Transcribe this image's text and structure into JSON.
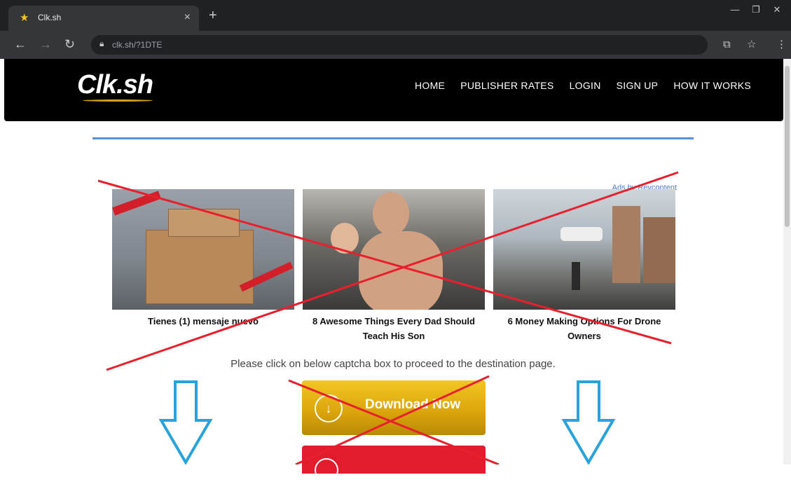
{
  "browser": {
    "tab_title": "Clk.sh",
    "tab_close": "×",
    "new_tab": "+",
    "url": "clk.sh/?1DTE",
    "window_controls": [
      "—",
      "❐",
      "✕"
    ]
  },
  "site": {
    "logo": "Clk.sh",
    "nav": [
      "HOME",
      "PUBLISHER RATES",
      "LOGIN",
      "SIGN UP",
      "HOW IT WORKS"
    ]
  },
  "ads": {
    "ads_by": "Ads by Revcontent",
    "cards": [
      {
        "title": "Tienes (1) mensaje nuevo"
      },
      {
        "title": "8 Awesome Things Every Dad Should Teach His Son"
      },
      {
        "title": "6 Money Making Options For Drone Owners"
      }
    ]
  },
  "instruction": "Please click on below captcha box to proceed to the destination page.",
  "download_button": "Download Now",
  "colors": {
    "header_bg": "#000000",
    "accent_blue": "#5b8fd6",
    "cross_red": "#e8202e",
    "arrow_blue": "#29a3dc",
    "download_gold": "#d9a40b"
  }
}
